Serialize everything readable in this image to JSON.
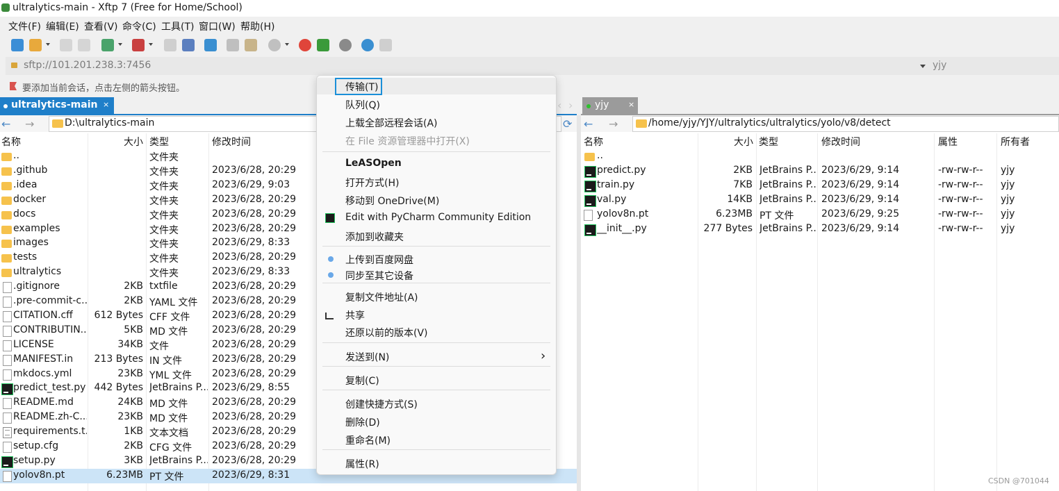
{
  "window": {
    "title": "ultralytics-main - Xftp 7 (Free for Home/School)"
  },
  "menubar": [
    "文件(F)",
    "编辑(E)",
    "查看(V)",
    "命令(C)",
    "工具(T)",
    "窗口(W)",
    "帮助(H)"
  ],
  "toolbar_icons": [
    "new-session-icon",
    "open-folder-icon",
    "connect-icon",
    "disconnect-icon",
    "new-tab-icon",
    "run-icon",
    "file-icon",
    "transfer-icon",
    "sync-icon",
    "copy-icon",
    "paste-icon",
    "stop-icon",
    "record-icon",
    "xshell-icon",
    "settings-icon",
    "help-icon",
    "chat-icon"
  ],
  "address": {
    "url": "sftp://101.201.238.3:7456",
    "session": "yjy"
  },
  "hint": "要添加当前会话，点击左侧的箭头按钮。",
  "tabs": {
    "left": {
      "label": "ultralytics-main",
      "close": "×"
    },
    "right": {
      "label": "yjy",
      "close": "×"
    }
  },
  "left": {
    "path": "D:\\ultralytics-main",
    "columns": {
      "name": "名称",
      "size": "大小",
      "type": "类型",
      "modified": "修改时间"
    },
    "rows": [
      {
        "icon": "folder",
        "name": "..",
        "size": "",
        "type": "文件夹",
        "modified": ""
      },
      {
        "icon": "folder",
        "name": ".github",
        "size": "",
        "type": "文件夹",
        "modified": "2023/6/28, 20:29"
      },
      {
        "icon": "folder",
        "name": ".idea",
        "size": "",
        "type": "文件夹",
        "modified": "2023/6/29, 9:03"
      },
      {
        "icon": "folder",
        "name": "docker",
        "size": "",
        "type": "文件夹",
        "modified": "2023/6/28, 20:29"
      },
      {
        "icon": "folder",
        "name": "docs",
        "size": "",
        "type": "文件夹",
        "modified": "2023/6/28, 20:29"
      },
      {
        "icon": "folder",
        "name": "examples",
        "size": "",
        "type": "文件夹",
        "modified": "2023/6/28, 20:29"
      },
      {
        "icon": "folder",
        "name": "images",
        "size": "",
        "type": "文件夹",
        "modified": "2023/6/29, 8:33"
      },
      {
        "icon": "folder",
        "name": "tests",
        "size": "",
        "type": "文件夹",
        "modified": "2023/6/28, 20:29"
      },
      {
        "icon": "folder",
        "name": "ultralytics",
        "size": "",
        "type": "文件夹",
        "modified": "2023/6/29, 8:33"
      },
      {
        "icon": "file",
        "name": ".gitignore",
        "size": "2KB",
        "type": "txtfile",
        "modified": "2023/6/28, 20:29"
      },
      {
        "icon": "file",
        "name": ".pre-commit-c...",
        "size": "2KB",
        "type": "YAML 文件",
        "modified": "2023/6/28, 20:29"
      },
      {
        "icon": "file",
        "name": "CITATION.cff",
        "size": "612 Bytes",
        "type": "CFF 文件",
        "modified": "2023/6/28, 20:29"
      },
      {
        "icon": "file",
        "name": "CONTRIBUTIN...",
        "size": "5KB",
        "type": "MD 文件",
        "modified": "2023/6/28, 20:29"
      },
      {
        "icon": "file",
        "name": "LICENSE",
        "size": "34KB",
        "type": "文件",
        "modified": "2023/6/28, 20:29"
      },
      {
        "icon": "file",
        "name": "MANIFEST.in",
        "size": "213 Bytes",
        "type": "IN 文件",
        "modified": "2023/6/28, 20:29"
      },
      {
        "icon": "file",
        "name": "mkdocs.yml",
        "size": "23KB",
        "type": "YML 文件",
        "modified": "2023/6/28, 20:29"
      },
      {
        "icon": "pycharm",
        "name": "predict_test.py",
        "size": "442 Bytes",
        "type": "JetBrains P...",
        "modified": "2023/6/29, 8:55"
      },
      {
        "icon": "file",
        "name": "README.md",
        "size": "24KB",
        "type": "MD 文件",
        "modified": "2023/6/28, 20:29"
      },
      {
        "icon": "file",
        "name": "README.zh-C...",
        "size": "23KB",
        "type": "MD 文件",
        "modified": "2023/6/28, 20:29"
      },
      {
        "icon": "text",
        "name": "requirements.t...",
        "size": "1KB",
        "type": "文本文档",
        "modified": "2023/6/28, 20:29"
      },
      {
        "icon": "file",
        "name": "setup.cfg",
        "size": "2KB",
        "type": "CFG 文件",
        "modified": "2023/6/28, 20:29"
      },
      {
        "icon": "pycharm",
        "name": "setup.py",
        "size": "3KB",
        "type": "JetBrains P...",
        "modified": "2023/6/28, 20:29"
      },
      {
        "icon": "file",
        "name": "yolov8n.pt",
        "size": "6.23MB",
        "type": "PT 文件",
        "modified": "2023/6/29, 8:31",
        "selected": true
      }
    ]
  },
  "right": {
    "path": "/home/yjy/YJY/ultralytics/ultralytics/yolo/v8/detect",
    "columns": {
      "name": "名称",
      "size": "大小",
      "type": "类型",
      "modified": "修改时间",
      "perm": "属性",
      "owner": "所有者"
    },
    "rows": [
      {
        "icon": "folder",
        "name": "..",
        "size": "",
        "type": "",
        "modified": "",
        "perm": "",
        "owner": ""
      },
      {
        "icon": "pycharm",
        "name": "predict.py",
        "size": "2KB",
        "type": "JetBrains P...",
        "modified": "2023/6/29, 9:14",
        "perm": "-rw-rw-r--",
        "owner": "yjy"
      },
      {
        "icon": "pycharm",
        "name": "train.py",
        "size": "7KB",
        "type": "JetBrains P...",
        "modified": "2023/6/29, 9:14",
        "perm": "-rw-rw-r--",
        "owner": "yjy"
      },
      {
        "icon": "pycharm",
        "name": "val.py",
        "size": "14KB",
        "type": "JetBrains P...",
        "modified": "2023/6/29, 9:14",
        "perm": "-rw-rw-r--",
        "owner": "yjy"
      },
      {
        "icon": "file",
        "name": "yolov8n.pt",
        "size": "6.23MB",
        "type": "PT 文件",
        "modified": "2023/6/29, 9:25",
        "perm": "-rw-rw-r--",
        "owner": "yjy"
      },
      {
        "icon": "pycharm",
        "name": "__init__.py",
        "size": "277 Bytes",
        "type": "JetBrains P...",
        "modified": "2023/6/29, 9:14",
        "perm": "-rw-rw-r--",
        "owner": "yjy"
      }
    ]
  },
  "context_menu": [
    {
      "label": "传输(T)",
      "highlight": true
    },
    {
      "label": "队列(Q)"
    },
    {
      "label": "上载全部远程会话(A)"
    },
    {
      "label": "在 File 资源管理器中打开(X)",
      "disabled": true
    },
    {
      "sep": true
    },
    {
      "label": "LeASOpen",
      "bold": true
    },
    {
      "label": "打开方式(H)"
    },
    {
      "label": "移动到 OneDrive(M)"
    },
    {
      "label": "Edit with PyCharm Community Edition",
      "icon": "pycharm-icon"
    },
    {
      "label": "添加到收藏夹"
    },
    {
      "sep": true
    },
    {
      "label": "上传到百度网盘",
      "icon": "baidu-cloud-icon"
    },
    {
      "label": "同步至其它设备",
      "icon": "baidu-cloud-icon"
    },
    {
      "sep": true
    },
    {
      "label": "复制文件地址(A)"
    },
    {
      "label": "共享",
      "icon": "share-icon"
    },
    {
      "label": "还原以前的版本(V)"
    },
    {
      "sep": true
    },
    {
      "label": "发送到(N)",
      "submenu": "›"
    },
    {
      "sep": true
    },
    {
      "label": "复制(C)"
    },
    {
      "sep": true
    },
    {
      "label": "创建快捷方式(S)"
    },
    {
      "label": "删除(D)"
    },
    {
      "label": "重命名(M)"
    },
    {
      "sep": true
    },
    {
      "label": "属性(R)"
    }
  ],
  "watermark": "CSDN @701044"
}
